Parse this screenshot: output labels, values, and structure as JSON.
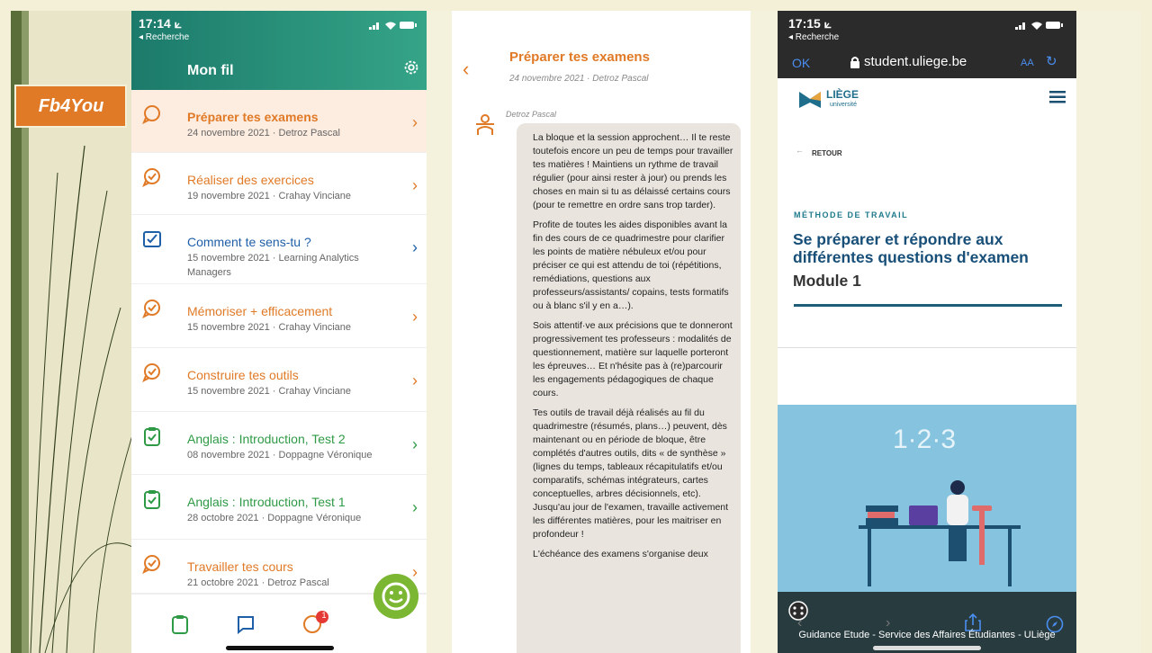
{
  "brand": {
    "label": "Fb4You"
  },
  "phone1": {
    "status_time": "17:14 ⟀",
    "back_label": "◂ Recherche",
    "title": "Mon fil",
    "items": [
      {
        "title": "Préparer tes examens",
        "meta": "24 novembre 2021 · Detroz Pascal",
        "color": "#e07a27",
        "icon": "speech-bubble-icon",
        "active": true
      },
      {
        "title": "Réaliser des exercices",
        "meta": "19 novembre 2021 · Crahay Vinciane",
        "color": "#e07a27",
        "icon": "check-bubble-icon"
      },
      {
        "title": "Comment te sens-tu ?",
        "meta": "15 novembre 2021 · Learning Analytics",
        "meta2": "Managers",
        "color": "#1f5fa8",
        "icon": "check-square-icon"
      },
      {
        "title": "Mémoriser + efficacement",
        "meta": "15 novembre 2021 · Crahay Vinciane",
        "color": "#e07a27",
        "icon": "check-bubble-icon"
      },
      {
        "title": "Construire tes outils",
        "meta": "15 novembre 2021 · Crahay Vinciane",
        "color": "#e07a27",
        "icon": "check-bubble-icon"
      },
      {
        "title": "Anglais : Introduction, Test 2",
        "meta": "08 novembre 2021 · Doppagne Véronique",
        "color": "#2f9a46",
        "icon": "clipboard-check-icon"
      },
      {
        "title": "Anglais : Introduction, Test 1",
        "meta": "28 octobre 2021 · Doppagne Véronique",
        "color": "#2f9a46",
        "icon": "clipboard-check-icon"
      },
      {
        "title": "Travailler tes cours",
        "meta": "21 octobre 2021 · Detroz Pascal",
        "color": "#e07a27",
        "icon": "check-bubble-icon"
      }
    ],
    "tab_badge": "1"
  },
  "phone2": {
    "title": "Préparer tes examens",
    "subtitle": "24 novembre 2021 · Detroz Pascal",
    "author": "Detroz Pascal",
    "paragraphs": [
      "La bloque et la session approchent… Il te reste toutefois encore un peu de temps pour travailler tes matières ! Maintiens un rythme de travail régulier (pour ainsi rester à jour) ou prends les choses en main si tu as délaissé certains cours (pour te remettre en ordre sans trop tarder).",
      "Profite de toutes les aides disponibles avant la fin des cours de ce quadrimestre pour clarifier les points de matière nébuleux et/ou pour préciser ce qui est attendu de toi (répétitions, remédiations, questions aux professeurs/assistants/ copains, tests formatifs ou à blanc s'il y en a…).",
      "Sois attentif·ve aux précisions que te donneront progressivement tes professeurs : modalités de questionnement, matière sur laquelle porteront les épreuves… Et n'hésite pas à (re)parcourir les engagements pédagogiques de chaque cours.",
      "Tes outils de travail déjà réalisés au fil du quadrimestre (résumés, plans…) peuvent, dès maintenant ou en période de bloque, être complétés d'autres outils, dits « de synthèse » (lignes du temps, tableaux récapitulatifs et/ou comparatifs, schémas intégrateurs, cartes conceptuelles, arbres décisionnels, etc). Jusqu'au jour de l'examen, travaille activement les différentes matières, pour les maitriser en profondeur !",
      "L'échéance des examens s'organise deux"
    ]
  },
  "phone3": {
    "status_time": "17:15 ⟀",
    "back_label": "◂ Recherche",
    "ok_label": "OK",
    "url": "student.uliege.be",
    "aa_label": "AA",
    "logo_text": "LIÈGE",
    "logo_sub": "université",
    "retour_label": "RETOUR",
    "category": "MÉTHODE DE TRAVAIL",
    "heading": "Se préparer et répondre aux différentes questions d'examen",
    "module": "Module 1",
    "illus_number": "1·2·3",
    "caption": "Guidance Etude - Service des Affaires Étudiantes - ULiège"
  }
}
